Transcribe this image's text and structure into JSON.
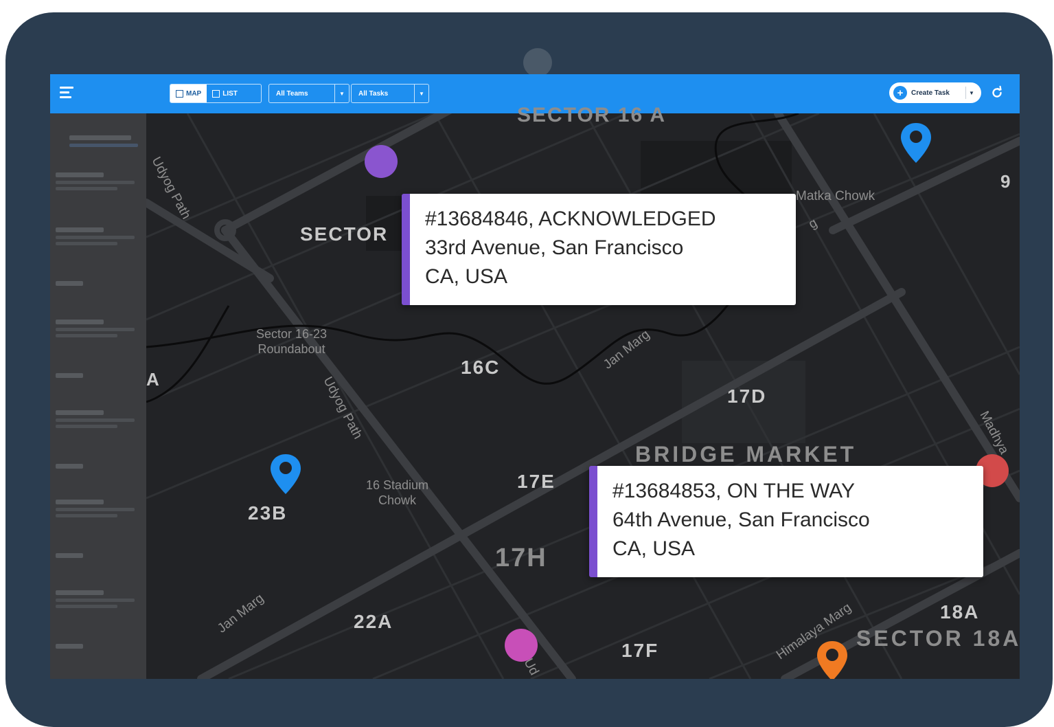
{
  "toolbar": {
    "view_map_label": "MAP",
    "view_list_label": "LIST",
    "teams_filter": "All Teams",
    "tasks_filter": "All Tasks",
    "create_task_label": "Create Task",
    "brand_color": "#1e8ff0"
  },
  "map": {
    "labels": {
      "sector_16a_partial": "SECTOR 16 A",
      "sector": "SECTOR",
      "matka_chowk": "Matka Chowk",
      "nine_partial": "9",
      "roundabout": "Sector 16-23\nRoundabout",
      "a_partial": "A",
      "s16c": "16C",
      "s17d": "17D",
      "bridge_market": "BRIDGE MARKET",
      "s17e": "17E",
      "stadium_chowk": "16 Stadium\nChowk",
      "s23b": "23B",
      "s17h": "17H",
      "s22a": "22A",
      "s17f": "17F",
      "s18a": "18A",
      "sector_18a": "SECTOR 18A",
      "udyog_path_1": "Udyog Path",
      "udyog_path_2": "Udyog Path",
      "jan_marg_1": "Jan Marg",
      "jan_marg_2": "Jan Marg",
      "himalaya_marg": "Himalaya Marg",
      "madhya_partial": "Madhya",
      "ud_partial": "Ud",
      "g_partial": "g"
    },
    "markers": {
      "blue_pin_color": "#1e8ff0",
      "orange_pin_color": "#f07a22",
      "purple_dot_color": "#8a55cf",
      "magenta_dot_color": "#c84fb8",
      "red_dot_color": "#d24a4a"
    }
  },
  "tasks": [
    {
      "id_status": "#13684846, ACKNOWLEDGED",
      "address_line1": "33rd Avenue, San Francisco",
      "address_line2": "CA, USA",
      "accent_color": "#7b4fd0"
    },
    {
      "id_status": "#13684853, ON THE WAY",
      "address_line1": "64th Avenue, San Francisco",
      "address_line2": "CA, USA",
      "accent_color": "#7b4fd0"
    }
  ]
}
